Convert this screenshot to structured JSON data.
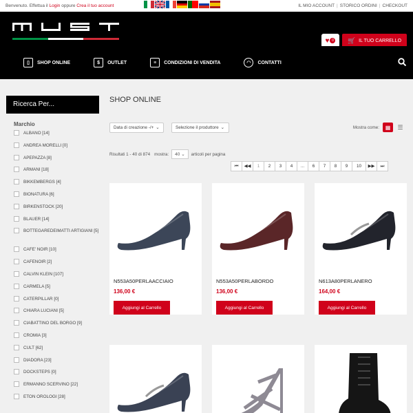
{
  "colors": {
    "accent": "#d0021b",
    "header_bg": "#000000",
    "page_bg": "#f0f0f0"
  },
  "topbar": {
    "welcome_prefix": "Benvenuto. Effettua il",
    "login": "Login",
    "or": "oppure",
    "register": "Crea il tuo account",
    "links": [
      "IL MIO ACCOUNT",
      "STORICO ORDINI",
      "CHECKOUT"
    ],
    "languages": [
      "italian-flag-icon",
      "english-flag-icon",
      "french-flag-icon",
      "german-flag-icon",
      "portuguese-flag-icon",
      "russian-flag-icon",
      "spanish-flag-icon"
    ]
  },
  "header": {
    "logo_text": "MUST",
    "wishlist_count": "0",
    "cart_label": "IL TUO CARRELLO"
  },
  "nav": {
    "items": [
      {
        "label": "SHOP ONLINE",
        "icon": "phone-icon"
      },
      {
        "label": "OUTLET",
        "icon": "money-icon"
      },
      {
        "label": "CONDIZIONI DI VENDITA",
        "icon": "document-icon"
      },
      {
        "label": "CONTATTI",
        "icon": "headset-icon"
      }
    ]
  },
  "sidebar": {
    "title": "Ricerca Per...",
    "filter_title": "Marchio",
    "brands": [
      "ALBANO [14]",
      "ANDREA MORELLI [0]",
      "APEPAZZA [8]",
      "ARMANI [18]",
      "BIKKEMBERGS [4]",
      "BIONATURA [6]",
      "BIRKENSTOCK [20]",
      "BLAUER [14]",
      "BOTTEGAREDEIMATTI ARTIGIANI [5]",
      "CAFE' NOIR [10]",
      "CAFENOIR [2]",
      "CALVIN KLEIN [107]",
      "CARMELA [5]",
      "CATERPILLAR [0]",
      "CHIARA LUCIANI [5]",
      "CIABATTINO DEL BORGO [9]",
      "CROMIA [3]",
      "CULT [62]",
      "DIADORA [23]",
      "DOCKSTEPS [0]",
      "ERMANNO SCERVINO [22]",
      "ETON OROLOGI [28]"
    ]
  },
  "main": {
    "title": "SHOP ONLINE",
    "sort_select": "Data di creazione -/+",
    "producer_select": "Selezione il produttore",
    "view_as": "Mostra come:",
    "results_text": "Risultati 1 - 40 di 874",
    "show_label": "mostra:",
    "per_page_value": "40",
    "per_page_suffix": "articoli per pagina",
    "pagination": [
      "⏮",
      "◀◀",
      "1",
      "2",
      "3",
      "4",
      "...",
      "6",
      "7",
      "8",
      "9",
      "10",
      "▶▶",
      "⏭"
    ]
  },
  "products": [
    {
      "name": "N553A50PERLAACCIAIO",
      "price": "136,00 €",
      "button": "Aggiungi al Carrello",
      "color": "#3c4658"
    },
    {
      "name": "N553A50PERLABORDO",
      "price": "136,00 €",
      "button": "Aggiungi al Carrello",
      "color": "#5a2628"
    },
    {
      "name": "N613A80PERLANERO",
      "price": "164,00 €",
      "button": "Aggiungi al Carrello",
      "color": "#22242c"
    },
    {
      "name": "",
      "price": "",
      "button": "",
      "color": "#3a4254"
    },
    {
      "name": "",
      "price": "",
      "button": "",
      "color": "#8e8a94"
    },
    {
      "name": "",
      "price": "",
      "button": "",
      "color": "#151515"
    }
  ]
}
